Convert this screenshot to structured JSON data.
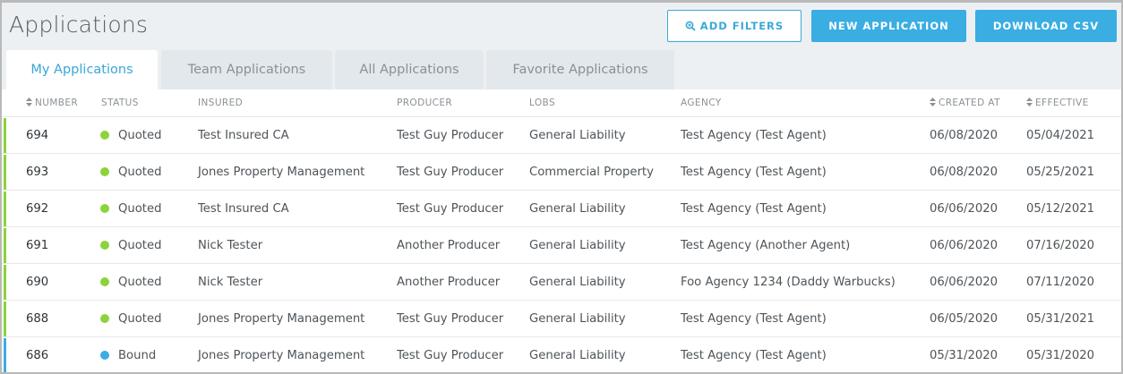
{
  "page": {
    "title": "Applications"
  },
  "toolbar": {
    "add_filters_label": "ADD FILTERS",
    "new_application_label": "NEW APPLICATION",
    "download_csv_label": "DOWNLOAD CSV",
    "accent_color": "#3aade3"
  },
  "tabs": [
    {
      "label": "My Applications",
      "active": true
    },
    {
      "label": "Team Applications",
      "active": false
    },
    {
      "label": "All Applications",
      "active": false
    },
    {
      "label": "Favorite Applications",
      "active": false
    }
  ],
  "table": {
    "columns": [
      "NUMBER",
      "STATUS",
      "INSURED",
      "PRODUCER",
      "LOBS",
      "AGENCY",
      "CREATED AT",
      "EFFECTIVE"
    ],
    "status_colors": {
      "Quoted": "#8bd33a",
      "Bound": "#3aade3"
    },
    "rows": [
      {
        "number": "694",
        "status": "Quoted",
        "insured": "Test Insured CA",
        "producer": "Test Guy Producer",
        "lobs": "General Liability",
        "agency": "Test Agency (Test Agent)",
        "created_at": "06/08/2020",
        "effective": "05/04/2021"
      },
      {
        "number": "693",
        "status": "Quoted",
        "insured": "Jones Property Management",
        "producer": "Test Guy Producer",
        "lobs": "Commercial Property",
        "agency": "Test Agency (Test Agent)",
        "created_at": "06/08/2020",
        "effective": "05/25/2021"
      },
      {
        "number": "692",
        "status": "Quoted",
        "insured": "Test Insured CA",
        "producer": "Test Guy Producer",
        "lobs": "General Liability",
        "agency": "Test Agency (Test Agent)",
        "created_at": "06/06/2020",
        "effective": "05/12/2021"
      },
      {
        "number": "691",
        "status": "Quoted",
        "insured": "Nick Tester",
        "producer": "Another Producer",
        "lobs": "General Liability",
        "agency": "Test Agency (Another Agent)",
        "created_at": "06/06/2020",
        "effective": "07/16/2020"
      },
      {
        "number": "690",
        "status": "Quoted",
        "insured": "Nick Tester",
        "producer": "Another Producer",
        "lobs": "General Liability",
        "agency": "Foo Agency 1234 (Daddy Warbucks)",
        "created_at": "06/06/2020",
        "effective": "07/11/2020"
      },
      {
        "number": "688",
        "status": "Quoted",
        "insured": "Jones Property Management",
        "producer": "Test Guy Producer",
        "lobs": "General Liability",
        "agency": "Test Agency (Test Agent)",
        "created_at": "06/05/2020",
        "effective": "05/31/2021"
      },
      {
        "number": "686",
        "status": "Bound",
        "insured": "Jones Property Management",
        "producer": "Test Guy Producer",
        "lobs": "General Liability",
        "agency": "Test Agency (Test Agent)",
        "created_at": "05/31/2020",
        "effective": "05/31/2020"
      }
    ]
  }
}
